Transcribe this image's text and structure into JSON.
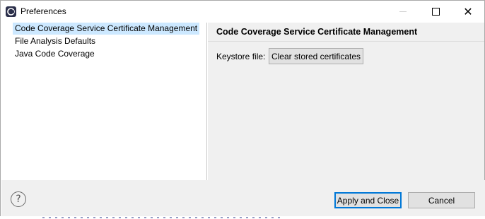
{
  "window": {
    "title": "Preferences"
  },
  "tree": {
    "items": [
      {
        "label": "Code Coverage Service Certificate Management",
        "selected": true
      },
      {
        "label": "File Analysis Defaults",
        "selected": false
      },
      {
        "label": "Java Code Coverage",
        "selected": false
      }
    ]
  },
  "panel": {
    "title": "Code Coverage Service Certificate Management",
    "keystore_label": "Keystore file:",
    "clear_button": "Clear stored certificates"
  },
  "footer": {
    "help_icon": "?",
    "apply_button": "Apply and Close",
    "cancel_button": "Cancel"
  },
  "colors": {
    "selection": "#cce8ff",
    "panel_bg": "#f0f0f0",
    "default_button_border": "#0078d7"
  }
}
